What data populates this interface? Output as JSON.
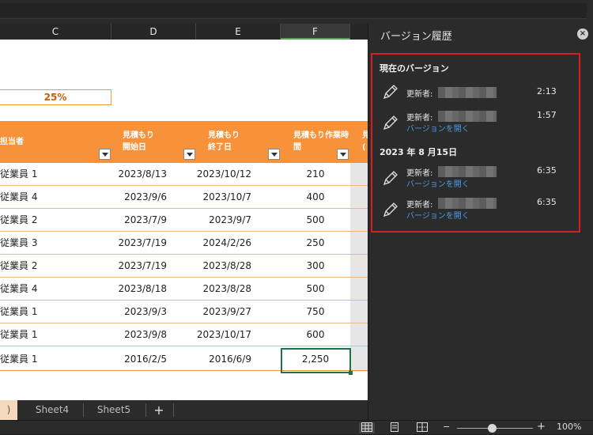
{
  "grid": {
    "columns": [
      {
        "letter": "C",
        "selected": false
      },
      {
        "letter": "D",
        "selected": false
      },
      {
        "letter": "E",
        "selected": false
      },
      {
        "letter": "F",
        "selected": true
      }
    ],
    "progress_value": "25%",
    "headers": {
      "assignee": "担当者",
      "start_1": "見積もり",
      "start_2": "開始日",
      "end_1": "見積もり",
      "end_2": "終了日",
      "hours_1": "見積もり作業時",
      "hours_2": "間",
      "next_1": "見",
      "next_2": "("
    },
    "rows": [
      {
        "assignee": "従業員 1",
        "start": "2023/8/13",
        "end": "2023/10/12",
        "hours": "210"
      },
      {
        "assignee": "従業員 4",
        "start": "2023/9/6",
        "end": "2023/10/7",
        "hours": "400"
      },
      {
        "assignee": "従業員 2",
        "start": "2023/7/9",
        "end": "2023/9/7",
        "hours": "500"
      },
      {
        "assignee": "従業員 3",
        "start": "2023/7/19",
        "end": "2024/2/26",
        "hours": "250"
      },
      {
        "assignee": "従業員 2",
        "start": "2023/7/19",
        "end": "2023/8/28",
        "hours": "300"
      },
      {
        "assignee": "従業員 4",
        "start": "2023/8/18",
        "end": "2023/8/28",
        "hours": "500"
      },
      {
        "assignee": "従業員 1",
        "start": "2023/9/3",
        "end": "2023/9/27",
        "hours": "750"
      },
      {
        "assignee": "従業員 1",
        "start": "2023/9/8",
        "end": "2023/10/17",
        "hours": "600"
      },
      {
        "assignee": "従業員 1",
        "start": "2016/2/5",
        "end": "2016/6/9",
        "hours": "2,250"
      }
    ]
  },
  "sheets": {
    "current_fragment": ")",
    "sheet4": "Sheet4",
    "sheet5": "Sheet5",
    "add": "+"
  },
  "status": {
    "zoom_minus": "−",
    "zoom_plus": "+",
    "zoom_level": "100%"
  },
  "panel": {
    "title": "バージョン履歴",
    "current_section": "現在のバージョン",
    "date_section": "2023 年 8 月15日",
    "updater_label": "更新者:",
    "open_version": "バージョンを開く",
    "versions": [
      {
        "time": "2:13"
      },
      {
        "time": "1:57"
      },
      {
        "time": "6:35"
      },
      {
        "time": "6:35"
      }
    ]
  },
  "colors": {
    "header_orange": "#f7923a",
    "link_blue": "#4a9ae8",
    "highlight_red": "#d61f1f",
    "selection_green": "#217346"
  }
}
